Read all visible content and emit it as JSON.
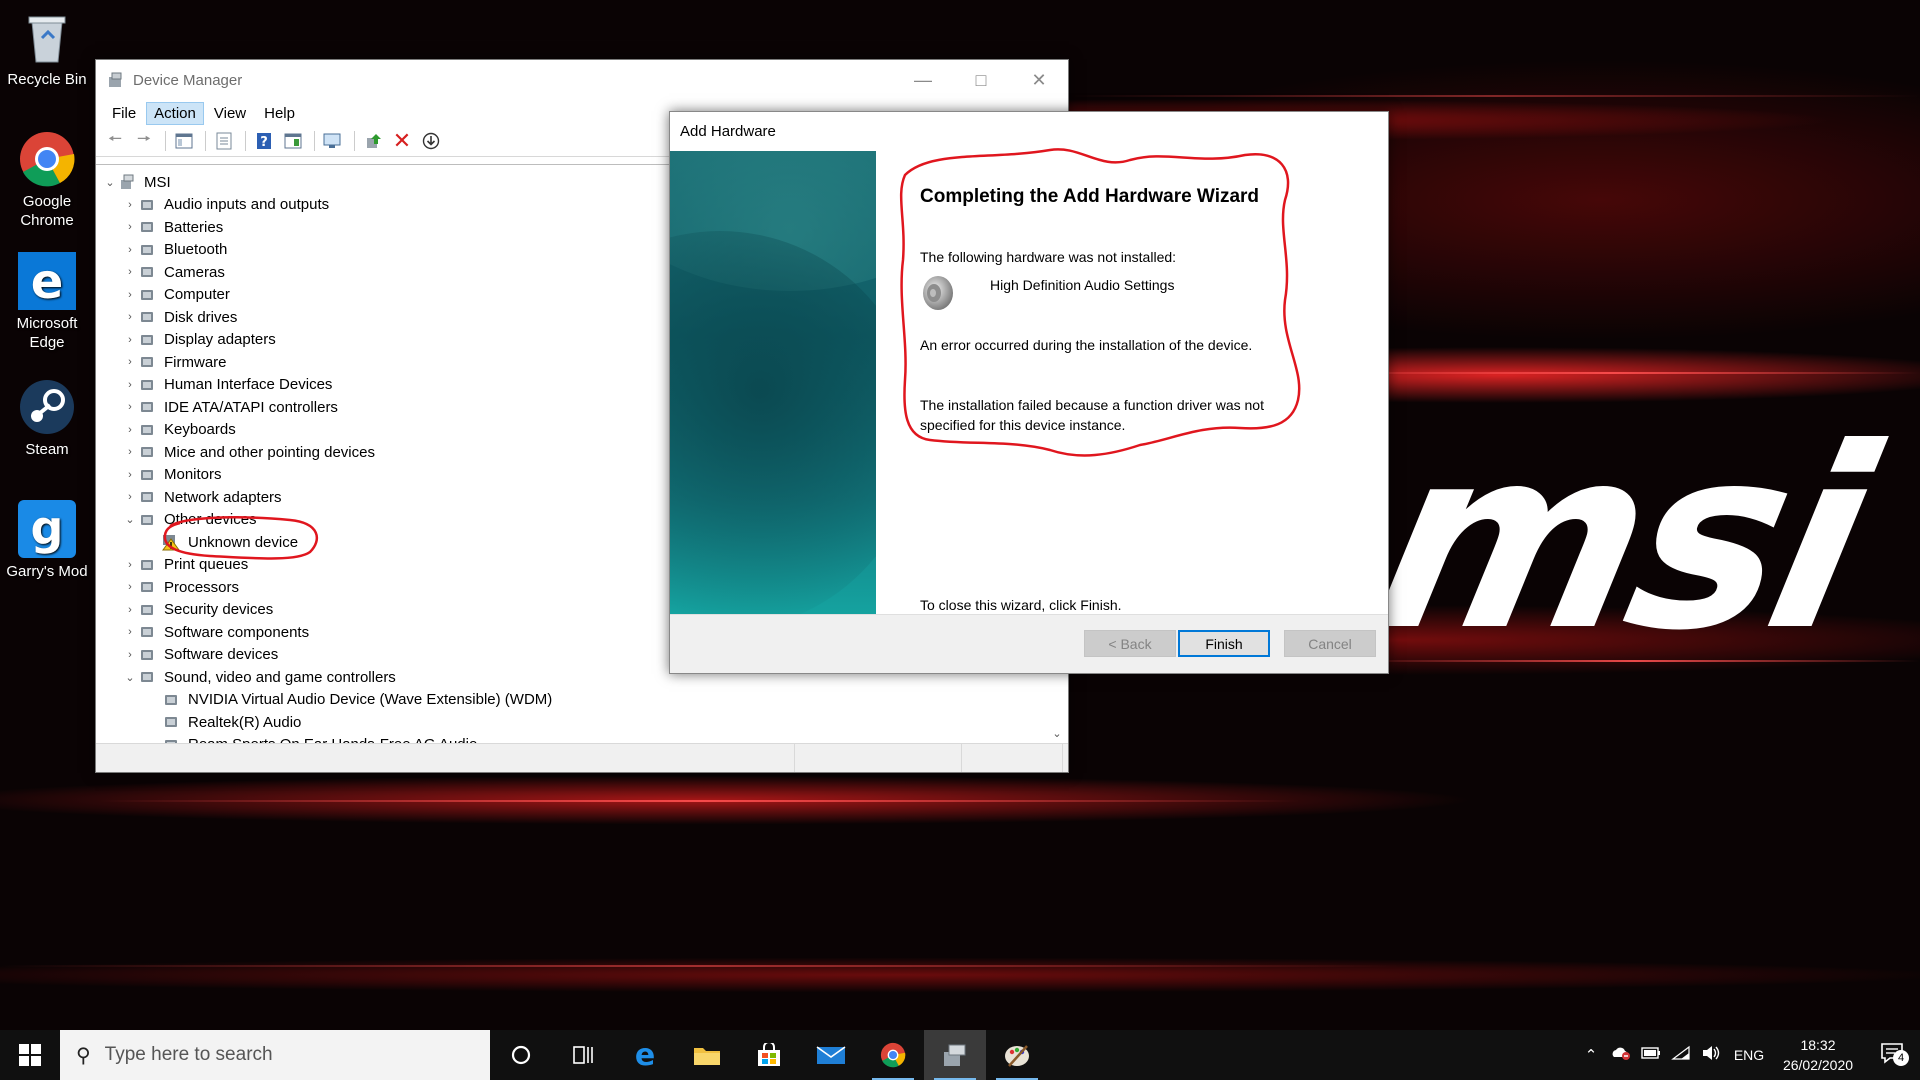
{
  "desktop": {
    "logo_text": "msi",
    "icons": [
      {
        "label": "Recycle Bin"
      },
      {
        "label": "Google Chrome"
      },
      {
        "label": "Microsoft Edge"
      },
      {
        "label": "Steam"
      },
      {
        "label": "Garry's Mod"
      }
    ]
  },
  "device_manager": {
    "title": "Device Manager",
    "menu": [
      "File",
      "Action",
      "View",
      "Help"
    ],
    "active_menu": "Action",
    "root": "MSI",
    "categories": [
      {
        "label": "Audio inputs and outputs",
        "icon": "speaker-icon"
      },
      {
        "label": "Batteries",
        "icon": "battery-icon"
      },
      {
        "label": "Bluetooth",
        "icon": "bluetooth-icon"
      },
      {
        "label": "Cameras",
        "icon": "camera-icon"
      },
      {
        "label": "Computer",
        "icon": "computer-icon"
      },
      {
        "label": "Disk drives",
        "icon": "disk-icon"
      },
      {
        "label": "Display adapters",
        "icon": "display-adapter-icon"
      },
      {
        "label": "Firmware",
        "icon": "firmware-icon"
      },
      {
        "label": "Human Interface Devices",
        "icon": "hid-icon"
      },
      {
        "label": "IDE ATA/ATAPI controllers",
        "icon": "ide-icon"
      },
      {
        "label": "Keyboards",
        "icon": "keyboard-icon"
      },
      {
        "label": "Mice and other pointing devices",
        "icon": "mouse-icon"
      },
      {
        "label": "Monitors",
        "icon": "monitor-icon"
      },
      {
        "label": "Network adapters",
        "icon": "network-icon"
      },
      {
        "label": "Other devices",
        "icon": "other-devices-icon",
        "expanded": true,
        "children": [
          {
            "label": "Unknown device",
            "icon": "warning-device-icon"
          }
        ]
      },
      {
        "label": "Print queues",
        "icon": "printer-icon"
      },
      {
        "label": "Processors",
        "icon": "processor-icon"
      },
      {
        "label": "Security devices",
        "icon": "security-device-icon"
      },
      {
        "label": "Software components",
        "icon": "software-component-icon"
      },
      {
        "label": "Software devices",
        "icon": "software-device-icon"
      },
      {
        "label": "Sound, video and game controllers",
        "icon": "speaker-icon",
        "expanded": true,
        "children": [
          {
            "label": "NVIDIA Virtual Audio Device (Wave Extensible) (WDM)",
            "icon": "speaker-icon"
          },
          {
            "label": "Realtek(R) Audio",
            "icon": "speaker-icon"
          },
          {
            "label": "Roam Sports On Ear Hands-Free AG Audio",
            "icon": "speaker-icon"
          }
        ]
      }
    ]
  },
  "add_hardware": {
    "title": "Add Hardware",
    "heading": "Completing the Add Hardware Wizard",
    "not_installed_label": "The following hardware was not installed:",
    "device_name": "High Definition Audio Settings",
    "error_text": "An error occurred during the installation of the device.",
    "failure_line1": "The installation failed because a function driver was not",
    "failure_line2": "specified for this device instance.",
    "close_hint": "To close this wizard, click Finish.",
    "buttons": {
      "back": "< Back",
      "finish": "Finish",
      "cancel": "Cancel"
    }
  },
  "taskbar": {
    "search_placeholder": "Type here to search",
    "language": "ENG",
    "time": "18:32",
    "date": "26/02/2020",
    "notification_count": "4"
  }
}
